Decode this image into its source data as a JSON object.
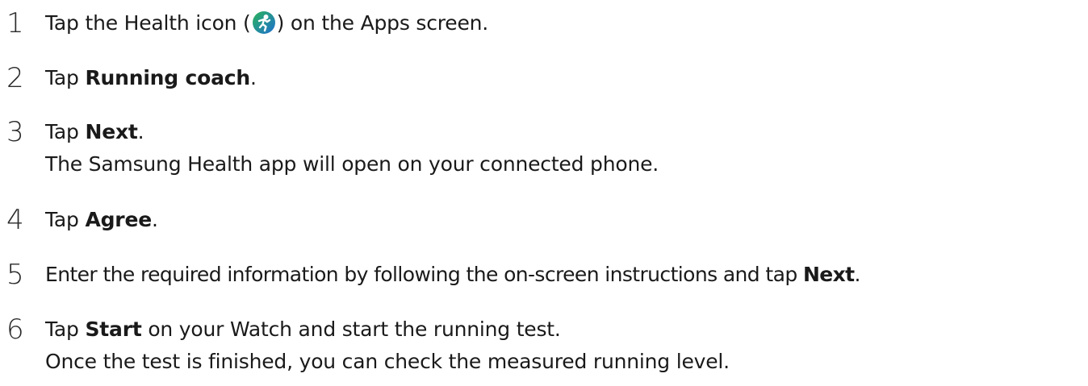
{
  "steps": [
    {
      "number": "1",
      "before_icon": "Tap the Health icon (",
      "icon": "health-app-icon",
      "after_icon": ") on the Apps screen."
    },
    {
      "number": "2",
      "prefix": "Tap ",
      "bold": "Running coach",
      "suffix": "."
    },
    {
      "number": "3",
      "prefix": "Tap ",
      "bold": "Next",
      "suffix": ".",
      "note": "The Samsung Health app will open on your connected phone."
    },
    {
      "number": "4",
      "prefix": "Tap ",
      "bold": "Agree",
      "suffix": "."
    },
    {
      "number": "5",
      "prefix": "Enter the required information by following the on-screen instructions and tap ",
      "bold": "Next",
      "suffix": "."
    },
    {
      "number": "6",
      "prefix": "Tap ",
      "bold": "Start",
      "suffix": " on your Watch and start the running test.",
      "note": "Once the test is finished, you can check the measured running level."
    }
  ],
  "colors": {
    "text": "#1a1a1a",
    "icon_green": "#2bb35a",
    "icon_blue": "#1e6fd0"
  }
}
